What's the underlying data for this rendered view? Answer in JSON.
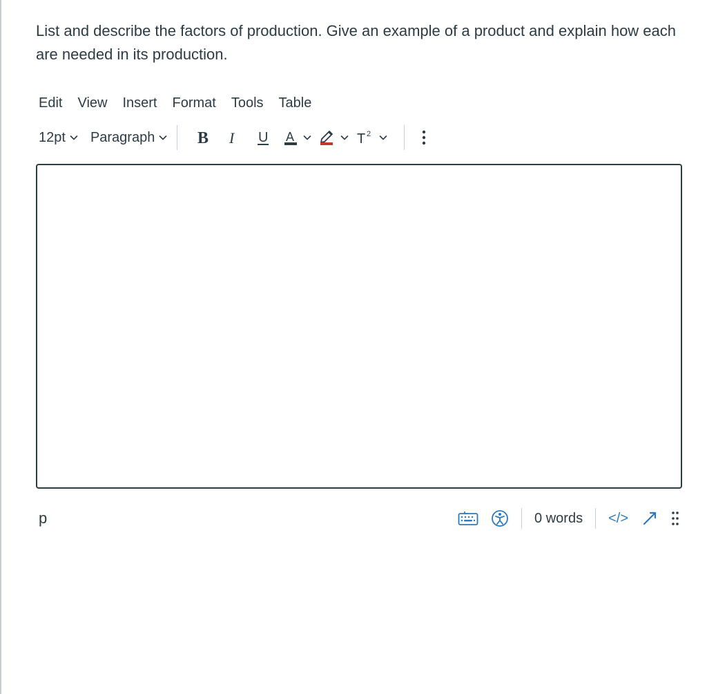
{
  "prompt_text": "List and describe the factors of production. Give an example of a product and explain how each are needed in its production.",
  "menubar": {
    "items": [
      "Edit",
      "View",
      "Insert",
      "Format",
      "Tools",
      "Table"
    ]
  },
  "toolbar": {
    "font_size": "12pt",
    "block_style": "Paragraph",
    "bold_label": "B",
    "italic_label": "I",
    "underline_label": "U",
    "text_color_label": "A",
    "highlight_label": "highlight",
    "superscript_label": "T²",
    "more_label": "more"
  },
  "editor": {
    "content": ""
  },
  "statusbar": {
    "element_path": "p",
    "word_count_label": "0 words",
    "html_view_label": "</>"
  },
  "colors": {
    "text": "#2d3b45",
    "link": "#2b7abb",
    "border": "#c7cdd1",
    "underline_red": "#c23b2a"
  }
}
